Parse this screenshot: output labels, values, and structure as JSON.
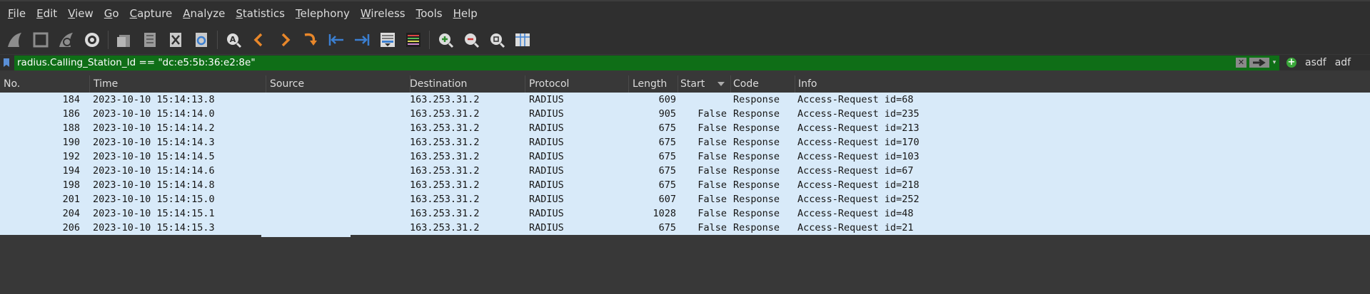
{
  "menu": [
    "File",
    "Edit",
    "View",
    "Go",
    "Capture",
    "Analyze",
    "Statistics",
    "Telephony",
    "Wireless",
    "Tools",
    "Help"
  ],
  "menu_mnemonic_index": [
    0,
    0,
    0,
    0,
    0,
    0,
    0,
    0,
    0,
    0,
    0
  ],
  "toolbar": {
    "icons": [
      "shark-fin-start-icon",
      "stop-capture-icon",
      "restart-capture-icon",
      "capture-options-gear-icon",
      "open-file-icon",
      "save-file-icon",
      "close-file-icon",
      "reload-file-icon",
      "find-packet-icon",
      "go-back-icon",
      "go-forward-icon",
      "go-to-packet-icon",
      "first-packet-icon",
      "last-packet-icon",
      "auto-scroll-icon",
      "colorize-icon",
      "zoom-in-icon",
      "zoom-out-icon",
      "normal-size-icon",
      "resize-columns-icon"
    ]
  },
  "filter": {
    "text": "radius.Calling_Station_Id == \"dc:e5:5b:36:e2:8e\"",
    "clear_glyph": "✕",
    "dropdown_glyph": "▾",
    "add_glyph": "+",
    "buttons": [
      "asdf",
      "adf"
    ],
    "color": "#0f6e17"
  },
  "columns": [
    "No.",
    "Time",
    "Source",
    "Destination",
    "Protocol",
    "Length",
    "Start",
    "Code",
    "Info"
  ],
  "rows": [
    {
      "no": "184",
      "time": "2023-10-10 15:14:13.8",
      "source": "",
      "destination": "163.253.31.2",
      "protocol": "RADIUS",
      "length": "609",
      "start": "",
      "code": "Response",
      "info": "Access-Request id=68"
    },
    {
      "no": "186",
      "time": "2023-10-10 15:14:14.0",
      "source": "",
      "destination": "163.253.31.2",
      "protocol": "RADIUS",
      "length": "905",
      "start": "False",
      "code": "Response",
      "info": "Access-Request id=235"
    },
    {
      "no": "188",
      "time": "2023-10-10 15:14:14.2",
      "source": "",
      "destination": "163.253.31.2",
      "protocol": "RADIUS",
      "length": "675",
      "start": "False",
      "code": "Response",
      "info": "Access-Request id=213"
    },
    {
      "no": "190",
      "time": "2023-10-10 15:14:14.3",
      "source": "",
      "destination": "163.253.31.2",
      "protocol": "RADIUS",
      "length": "675",
      "start": "False",
      "code": "Response",
      "info": "Access-Request id=170"
    },
    {
      "no": "192",
      "time": "2023-10-10 15:14:14.5",
      "source": "",
      "destination": "163.253.31.2",
      "protocol": "RADIUS",
      "length": "675",
      "start": "False",
      "code": "Response",
      "info": "Access-Request id=103"
    },
    {
      "no": "194",
      "time": "2023-10-10 15:14:14.6",
      "source": "",
      "destination": "163.253.31.2",
      "protocol": "RADIUS",
      "length": "675",
      "start": "False",
      "code": "Response",
      "info": "Access-Request id=67"
    },
    {
      "no": "198",
      "time": "2023-10-10 15:14:14.8",
      "source": "",
      "destination": "163.253.31.2",
      "protocol": "RADIUS",
      "length": "675",
      "start": "False",
      "code": "Response",
      "info": "Access-Request id=218"
    },
    {
      "no": "201",
      "time": "2023-10-10 15:14:15.0",
      "source": "",
      "destination": "163.253.31.2",
      "protocol": "RADIUS",
      "length": "607",
      "start": "False",
      "code": "Response",
      "info": "Access-Request id=252"
    },
    {
      "no": "204",
      "time": "2023-10-10 15:14:15.1",
      "source": "",
      "destination": "163.253.31.2",
      "protocol": "RADIUS",
      "length": "1028",
      "start": "False",
      "code": "Response",
      "info": "Access-Request id=48"
    },
    {
      "no": "206",
      "time": "2023-10-10 15:14:15.3",
      "source": "",
      "destination": "163.253.31.2",
      "protocol": "RADIUS",
      "length": "675",
      "start": "False",
      "code": "Response",
      "info": "Access-Request id=21"
    }
  ]
}
